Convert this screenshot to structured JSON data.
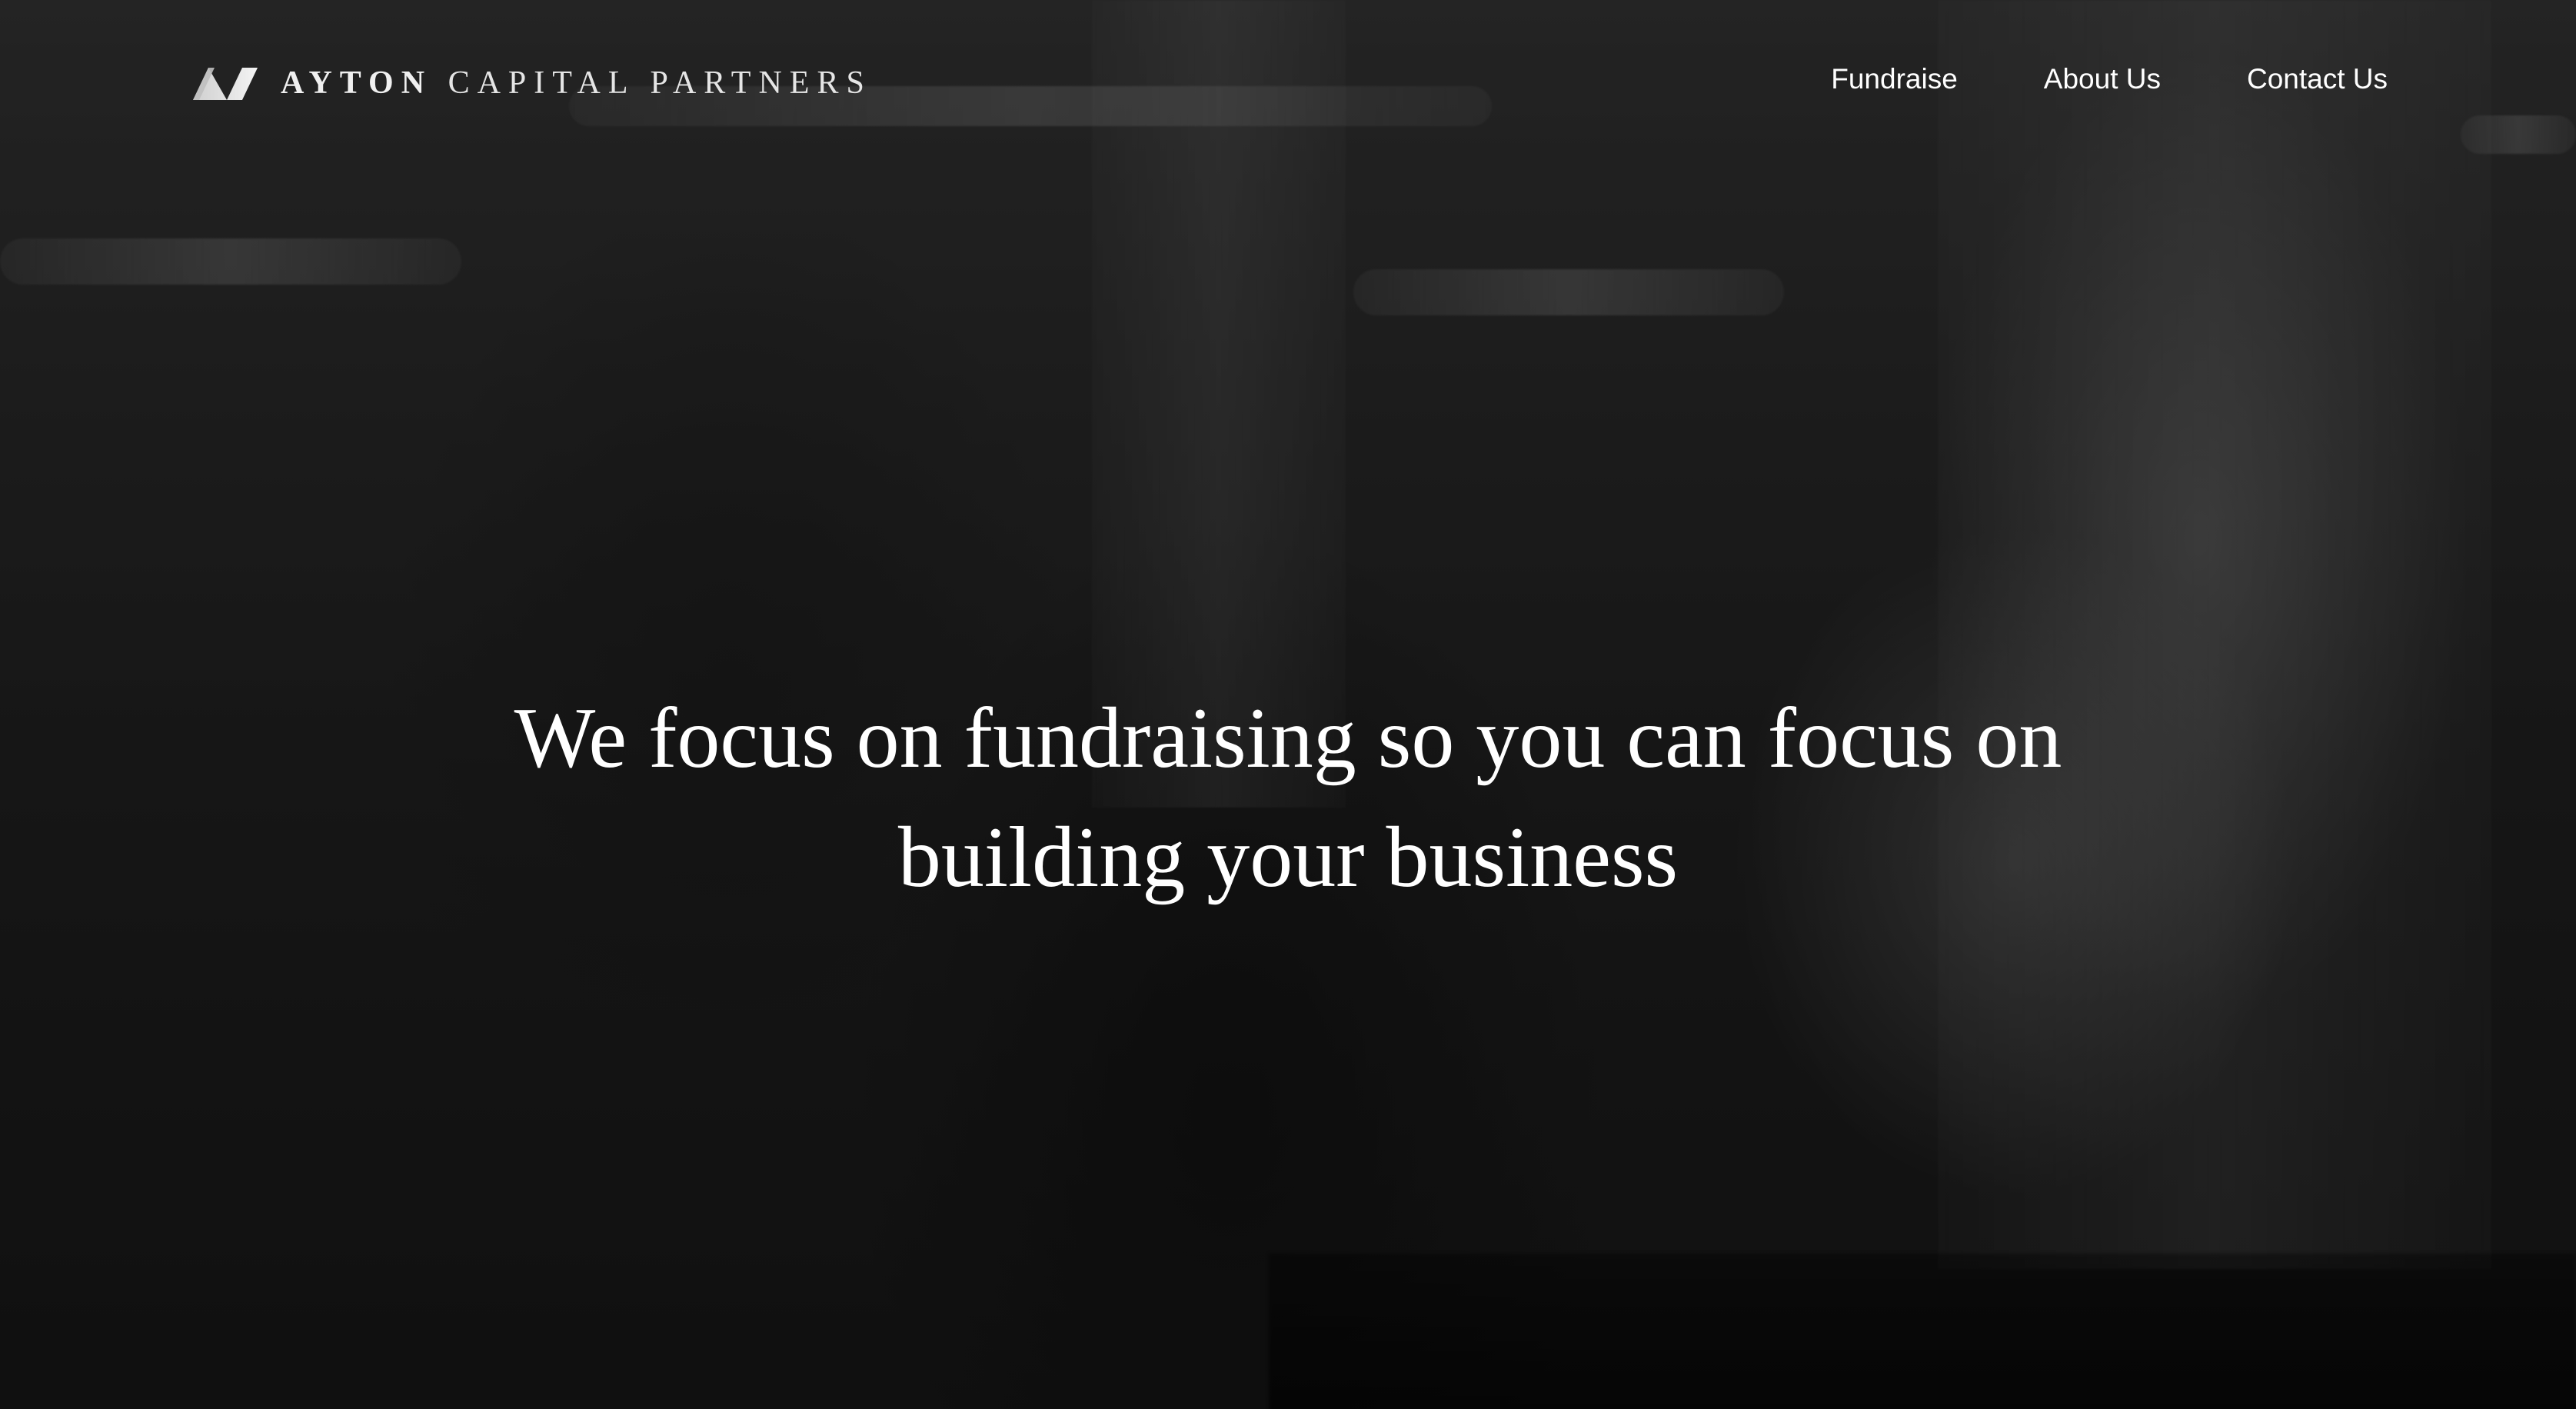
{
  "brand": {
    "name_primary": "AYTON",
    "name_secondary": "CAPITAL PARTNERS",
    "logo_icon": "ayton-logo-icon"
  },
  "nav": {
    "items": [
      {
        "label": "Fundraise"
      },
      {
        "label": "About Us"
      },
      {
        "label": "Contact Us"
      }
    ]
  },
  "hero": {
    "headline_line1": "We focus on fundraising so you can focus on",
    "headline_line2": "building your business",
    "image_tone": "monochrome",
    "colors": {
      "text": "#ffffff",
      "overlay": "rgba(0,0,0,0.38)"
    }
  }
}
